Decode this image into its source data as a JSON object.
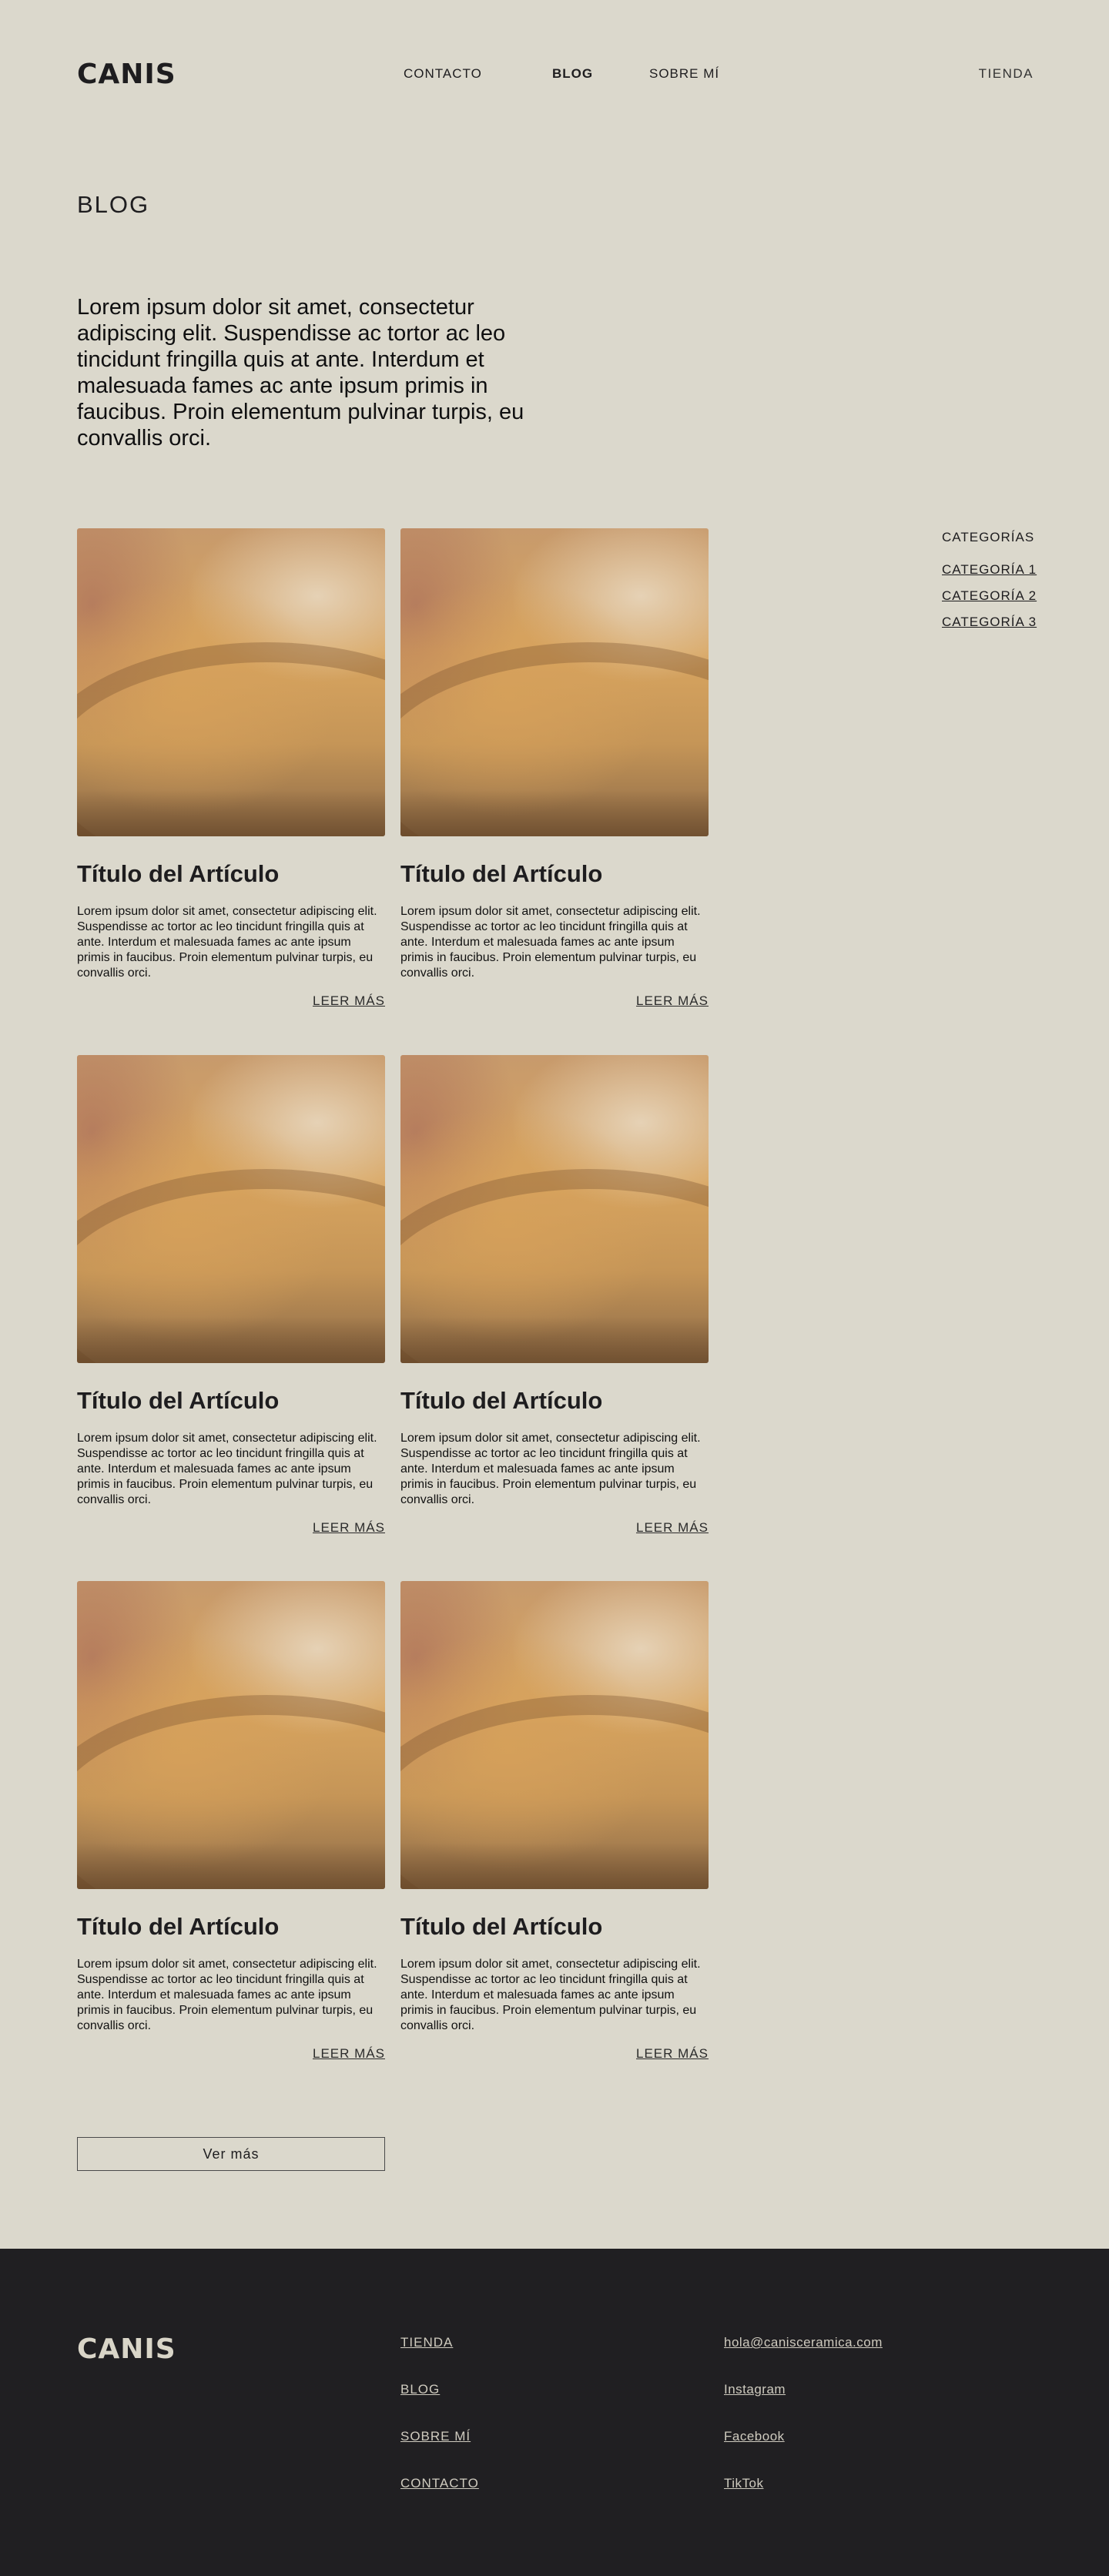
{
  "header": {
    "logo": "CANIS",
    "nav": {
      "contacto": "CONTACTO",
      "blog": "BLOG",
      "sobre": "SOBRE MÍ",
      "tienda": "TIENDA"
    }
  },
  "page_title": "BLOG",
  "intro": "Lorem ipsum dolor sit amet, consectetur adipiscing elit. Suspendisse ac tortor ac leo tincidunt fringilla quis at ante. Interdum et malesuada fames ac ante ipsum primis in faucibus. Proin elementum pulvinar turpis, eu convallis orci.",
  "articles": [
    {
      "title": "Título del Artículo",
      "text": "Lorem ipsum dolor sit amet, consectetur adipiscing elit. Suspendisse ac tortor ac leo tincidunt fringilla quis at ante. Interdum et malesuada fames ac ante ipsum primis in faucibus. Proin elementum pulvinar turpis, eu convallis orci.",
      "link": "LEER MÁS"
    },
    {
      "title": "Título del Artículo",
      "text": "Lorem ipsum dolor sit amet, consectetur adipiscing elit. Suspendisse ac tortor ac leo tincidunt fringilla quis at ante. Interdum et malesuada fames ac ante ipsum primis in faucibus. Proin elementum pulvinar turpis, eu convallis orci.",
      "link": "LEER MÁS"
    },
    {
      "title": "Título del Artículo",
      "text": "Lorem ipsum dolor sit amet, consectetur adipiscing elit. Suspendisse ac tortor ac leo tincidunt fringilla quis at ante. Interdum et malesuada fames ac ante ipsum primis in faucibus. Proin elementum pulvinar turpis, eu convallis orci.",
      "link": "LEER MÁS"
    },
    {
      "title": "Título del Artículo",
      "text": "Lorem ipsum dolor sit amet, consectetur adipiscing elit. Suspendisse ac tortor ac leo tincidunt fringilla quis at ante. Interdum et malesuada fames ac ante ipsum primis in faucibus. Proin elementum pulvinar turpis, eu convallis orci.",
      "link": "LEER MÁS"
    },
    {
      "title": "Título del Artículo",
      "text": "Lorem ipsum dolor sit amet, consectetur adipiscing elit. Suspendisse ac tortor ac leo tincidunt fringilla quis at ante. Interdum et malesuada fames ac ante ipsum primis in faucibus. Proin elementum pulvinar turpis, eu convallis orci.",
      "link": "LEER MÁS"
    },
    {
      "title": "Título del Artículo",
      "text": "Lorem ipsum dolor sit amet, consectetur adipiscing elit. Suspendisse ac tortor ac leo tincidunt fringilla quis at ante. Interdum et malesuada fames ac ante ipsum primis in faucibus. Proin elementum pulvinar turpis, eu convallis orci.",
      "link": "LEER MÁS"
    }
  ],
  "categories": {
    "title": "CATEGORÍAS",
    "items": [
      "CATEGORÍA 1",
      "CATEGORÍA 2",
      "CATEGORÍA 3"
    ]
  },
  "more_button": "Ver más",
  "footer": {
    "logo": "CANIS",
    "nav": [
      "TIENDA",
      "BLOG",
      "SOBRE MÍ",
      "CONTACTO"
    ],
    "social": [
      "hola@canisceramica.com",
      "Instagram",
      "Facebook",
      "TikTok"
    ]
  },
  "colors": {
    "background": "#dbd8cc",
    "text": "#1e1d1f",
    "footer_background": "#201f22",
    "footer_text": "#cfcbbf"
  }
}
